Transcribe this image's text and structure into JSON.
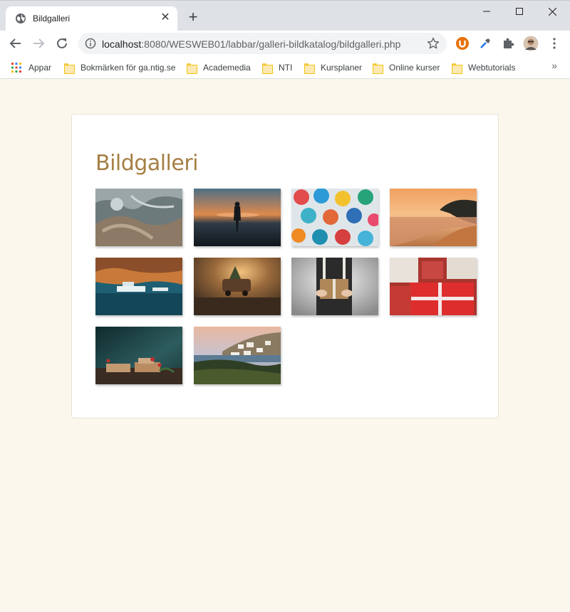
{
  "browser": {
    "tab_title": "Bildgalleri",
    "url_host": "localhost",
    "url_rest": ":8080/WESWEB01/labbar/galleri-bildkatalog/bildgalleri.php"
  },
  "bookmarks": [
    {
      "label": "Appar",
      "icon": "apps-grid-icon"
    },
    {
      "label": "Bokmärken för ga.ntig.se",
      "icon": "folder-icon"
    },
    {
      "label": "Academedia",
      "icon": "folder-icon"
    },
    {
      "label": "NTI",
      "icon": "folder-icon"
    },
    {
      "label": "Kursplaner",
      "icon": "folder-icon"
    },
    {
      "label": "Online kurser",
      "icon": "folder-icon"
    },
    {
      "label": "Webtutorials",
      "icon": "folder-icon"
    }
  ],
  "page": {
    "heading": "Bildgalleri",
    "heading_color": "#a57f44",
    "background_color": "#fbf7ec"
  },
  "gallery": [
    {
      "subject": "aerial coastline"
    },
    {
      "subject": "child silhouette at sunset beach"
    },
    {
      "subject": "colorful umbrellas"
    },
    {
      "subject": "beach at sunset"
    },
    {
      "subject": "harbor with boats"
    },
    {
      "subject": "toy van with tree"
    },
    {
      "subject": "person holding gift"
    },
    {
      "subject": "red gift boxes"
    },
    {
      "subject": "wrapped presents on table"
    },
    {
      "subject": "white village by the sea"
    }
  ]
}
